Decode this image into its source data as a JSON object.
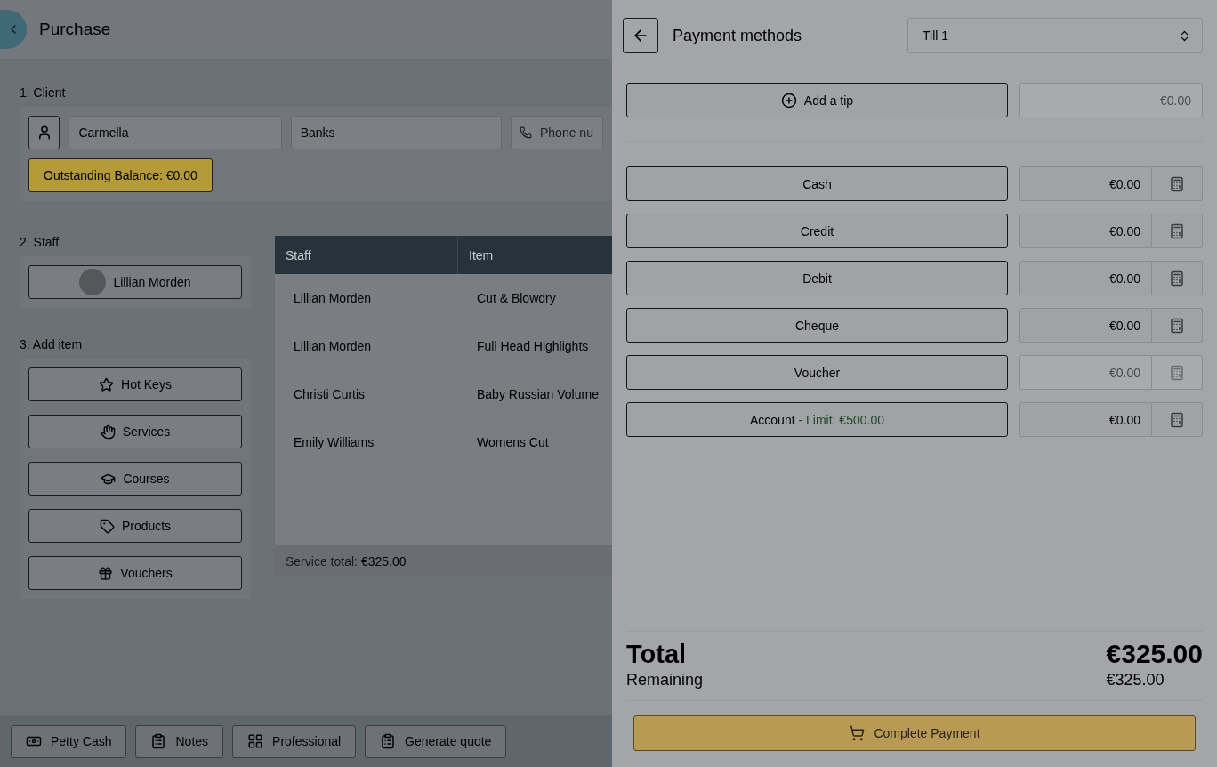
{
  "page": {
    "title": "Purchase"
  },
  "client": {
    "heading": "1. Client",
    "first_name": "Carmella",
    "last_name": "Banks",
    "phone_placeholder": "Phone nu",
    "balance": "Outstanding Balance: €0.00"
  },
  "staff": {
    "heading": "2. Staff",
    "selected_staff": "Lillian Morden"
  },
  "add_item": {
    "heading": "3. Add item",
    "buttons": [
      {
        "label": "Hot Keys"
      },
      {
        "label": "Services"
      },
      {
        "label": "Courses"
      },
      {
        "label": "Products"
      },
      {
        "label": "Vouchers"
      }
    ]
  },
  "table": {
    "columns": [
      "Staff",
      "Item"
    ],
    "rows": [
      [
        "Lillian Morden",
        "Cut & Blowdry"
      ],
      [
        "Lillian Morden",
        "Full Head Highlights"
      ],
      [
        "Christi Curtis",
        "Baby Russian Volume"
      ],
      [
        "Emily Williams",
        "Womens Cut"
      ]
    ],
    "footer_label": "Service total:",
    "footer_value": "€325.00"
  },
  "bottom_bar": [
    {
      "label": "Petty Cash"
    },
    {
      "label": "Notes"
    },
    {
      "label": "Professional"
    },
    {
      "label": "Generate quote"
    }
  ],
  "drawer": {
    "title": "Payment methods",
    "till": "Till 1",
    "tip": {
      "label": "Add a tip",
      "value": "€0.00",
      "disabled": true
    },
    "methods": [
      {
        "label": "Cash",
        "value": "€0.00",
        "disabled": false
      },
      {
        "label": "Credit",
        "value": "€0.00",
        "disabled": false
      },
      {
        "label": "Debit",
        "value": "€0.00",
        "disabled": false
      },
      {
        "label": "Cheque",
        "value": "€0.00",
        "disabled": false
      },
      {
        "label": "Voucher",
        "value": "€0.00",
        "disabled": true
      },
      {
        "label": "Account",
        "note": "- Limit: €500.00",
        "value": "€0.00",
        "disabled": false
      }
    ],
    "total_label": "Total",
    "total_value": "€325.00",
    "remaining_label": "Remaining",
    "remaining_value": "€325.00",
    "complete": "Complete Payment"
  }
}
